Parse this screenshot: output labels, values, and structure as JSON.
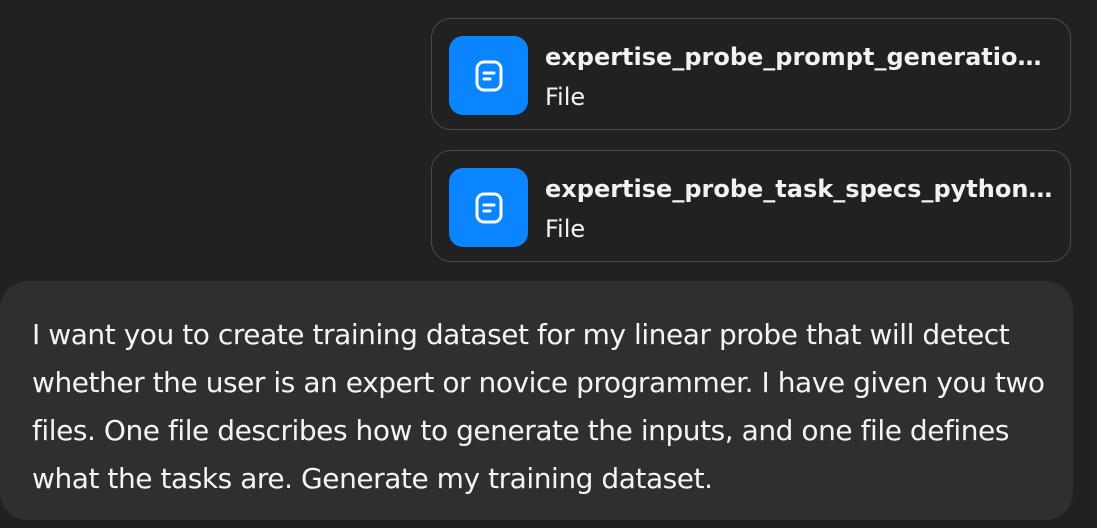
{
  "attachments": [
    {
      "name": "expertise_probe_prompt_generation_t...",
      "type": "File",
      "icon": "document-icon"
    },
    {
      "name": "expertise_probe_task_specs_python_pr...",
      "type": "File",
      "icon": "document-icon"
    }
  ],
  "message": {
    "text": "I want you to create training dataset for my linear probe that will detect whether the user is an expert or novice programmer. I have given you two files. One file describes how to generate the inputs, and one file defines what the tasks are. Generate my training dataset."
  },
  "colors": {
    "background": "#212121",
    "bubble": "#2f2f2f",
    "icon_accent": "#0a84ff",
    "text": "#f2f2f2",
    "card_border": "#4a4a4a"
  }
}
